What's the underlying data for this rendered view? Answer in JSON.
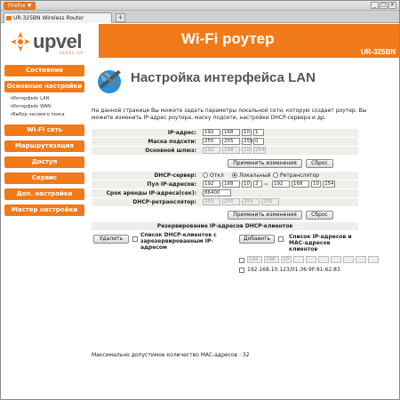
{
  "browser": {
    "app_button": "Firefox ▼",
    "tab_title": "UR-325BN Wireless Router",
    "new_tab": "+",
    "min": "_",
    "max": "□",
    "close": "✕"
  },
  "header": {
    "brand": "upvel",
    "brand_sub": "LEVEL UP",
    "title": "Wi-Fi роутер",
    "model": "UR-325BN"
  },
  "sidebar": {
    "items": [
      {
        "label": "Состояние"
      },
      {
        "label": "Основные настройки"
      },
      {
        "label": "Wi-Fi сеть"
      },
      {
        "label": "Маршрутизация"
      },
      {
        "label": "Доступ"
      },
      {
        "label": "Сервис"
      },
      {
        "label": "Доп. настройки"
      },
      {
        "label": "Мастер настройки"
      }
    ],
    "subitems": [
      {
        "label": "»Интерфейс LAN"
      },
      {
        "label": "»Интерфейс WAN"
      },
      {
        "label": "»Выбор часового пояса"
      }
    ]
  },
  "main": {
    "title": "Настройка интерфейса LAN",
    "description": "На данной странице Вы можете задать параметры локальной сети, которую создает роутер. Вы можете изменить IP-адрес роутера, маску подсети, настройки DHCP-сервера и др.",
    "ip_label": "IP-адрес:",
    "ip": [
      "192",
      "168",
      "10",
      "1"
    ],
    "mask_label": "Маска подсети:",
    "mask": [
      "255",
      "255",
      "255",
      "0"
    ],
    "gw_label": "Основной шлюз:",
    "gw": [
      "192",
      "168",
      "10",
      "254"
    ],
    "apply_label": "Применить изменения",
    "reset_label": "Сброс",
    "dhcp_label": "DHCP-сервер:",
    "dhcp_opts": [
      "Откл",
      "Локальный",
      "Ретранслятор"
    ],
    "pool_label": "Пул IP-адресов:",
    "pool_start": [
      "192",
      "168",
      "10",
      "2"
    ],
    "pool_sep": "~",
    "pool_end": [
      "192",
      "168",
      "10",
      "254"
    ],
    "lease_label": "Срок аренды IP-адреса(сек):",
    "lease": "86400",
    "relay_label": "DHCP-ретранслятор:",
    "relay": [
      "255",
      "255",
      "255",
      "255"
    ],
    "reserve_title": "Резервирование IP-адресов DHCP-клиентов",
    "delete_label": "Удалить",
    "reserved_list_label": "Список DHCP-клиентов с зарезервированным IP-адресом",
    "add_label": "Добавить",
    "ip_mac_list_label": "Список IP-адресов и MAC-адресов клиентов",
    "new_entry_ip": [
      "192",
      "168",
      "10",
      ""
    ],
    "client_entry": "192.168.10.123/01:36:9F:91:62:83",
    "max_mac": "Максимально допустимое количество MAC-адресов : 32"
  },
  "colors": {
    "accent": "#f07a1a"
  }
}
